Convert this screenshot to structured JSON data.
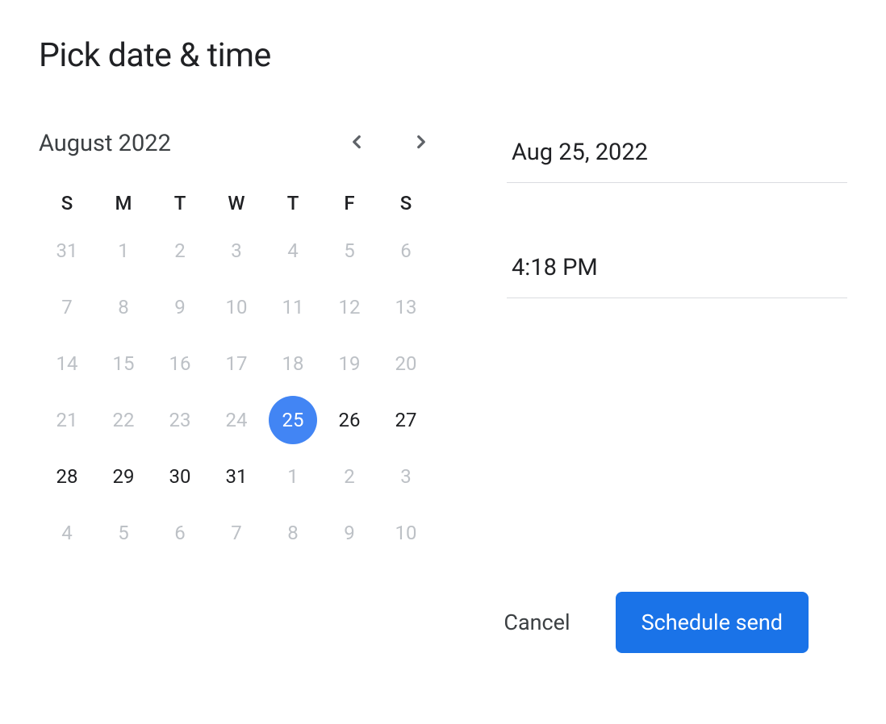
{
  "title": "Pick date & time",
  "calendar": {
    "month_label": "August 2022",
    "weekdays": [
      "S",
      "M",
      "T",
      "W",
      "T",
      "F",
      "S"
    ],
    "weeks": [
      [
        {
          "d": "31",
          "state": "muted"
        },
        {
          "d": "1",
          "state": "muted"
        },
        {
          "d": "2",
          "state": "muted"
        },
        {
          "d": "3",
          "state": "muted"
        },
        {
          "d": "4",
          "state": "muted"
        },
        {
          "d": "5",
          "state": "muted"
        },
        {
          "d": "6",
          "state": "muted"
        }
      ],
      [
        {
          "d": "7",
          "state": "muted"
        },
        {
          "d": "8",
          "state": "muted"
        },
        {
          "d": "9",
          "state": "muted"
        },
        {
          "d": "10",
          "state": "muted"
        },
        {
          "d": "11",
          "state": "muted"
        },
        {
          "d": "12",
          "state": "muted"
        },
        {
          "d": "13",
          "state": "muted"
        }
      ],
      [
        {
          "d": "14",
          "state": "muted"
        },
        {
          "d": "15",
          "state": "muted"
        },
        {
          "d": "16",
          "state": "muted"
        },
        {
          "d": "17",
          "state": "muted"
        },
        {
          "d": "18",
          "state": "muted"
        },
        {
          "d": "19",
          "state": "muted"
        },
        {
          "d": "20",
          "state": "muted"
        }
      ],
      [
        {
          "d": "21",
          "state": "muted"
        },
        {
          "d": "22",
          "state": "muted"
        },
        {
          "d": "23",
          "state": "muted"
        },
        {
          "d": "24",
          "state": "muted"
        },
        {
          "d": "25",
          "state": "selected"
        },
        {
          "d": "26",
          "state": "normal"
        },
        {
          "d": "27",
          "state": "normal"
        }
      ],
      [
        {
          "d": "28",
          "state": "normal"
        },
        {
          "d": "29",
          "state": "normal"
        },
        {
          "d": "30",
          "state": "normal"
        },
        {
          "d": "31",
          "state": "normal"
        },
        {
          "d": "1",
          "state": "muted"
        },
        {
          "d": "2",
          "state": "muted"
        },
        {
          "d": "3",
          "state": "muted"
        }
      ],
      [
        {
          "d": "4",
          "state": "muted"
        },
        {
          "d": "5",
          "state": "muted"
        },
        {
          "d": "6",
          "state": "muted"
        },
        {
          "d": "7",
          "state": "muted"
        },
        {
          "d": "8",
          "state": "muted"
        },
        {
          "d": "9",
          "state": "muted"
        },
        {
          "d": "10",
          "state": "muted"
        }
      ]
    ]
  },
  "inputs": {
    "date_value": "Aug 25, 2022",
    "time_value": "4:18 PM"
  },
  "actions": {
    "cancel_label": "Cancel",
    "schedule_label": "Schedule send"
  }
}
